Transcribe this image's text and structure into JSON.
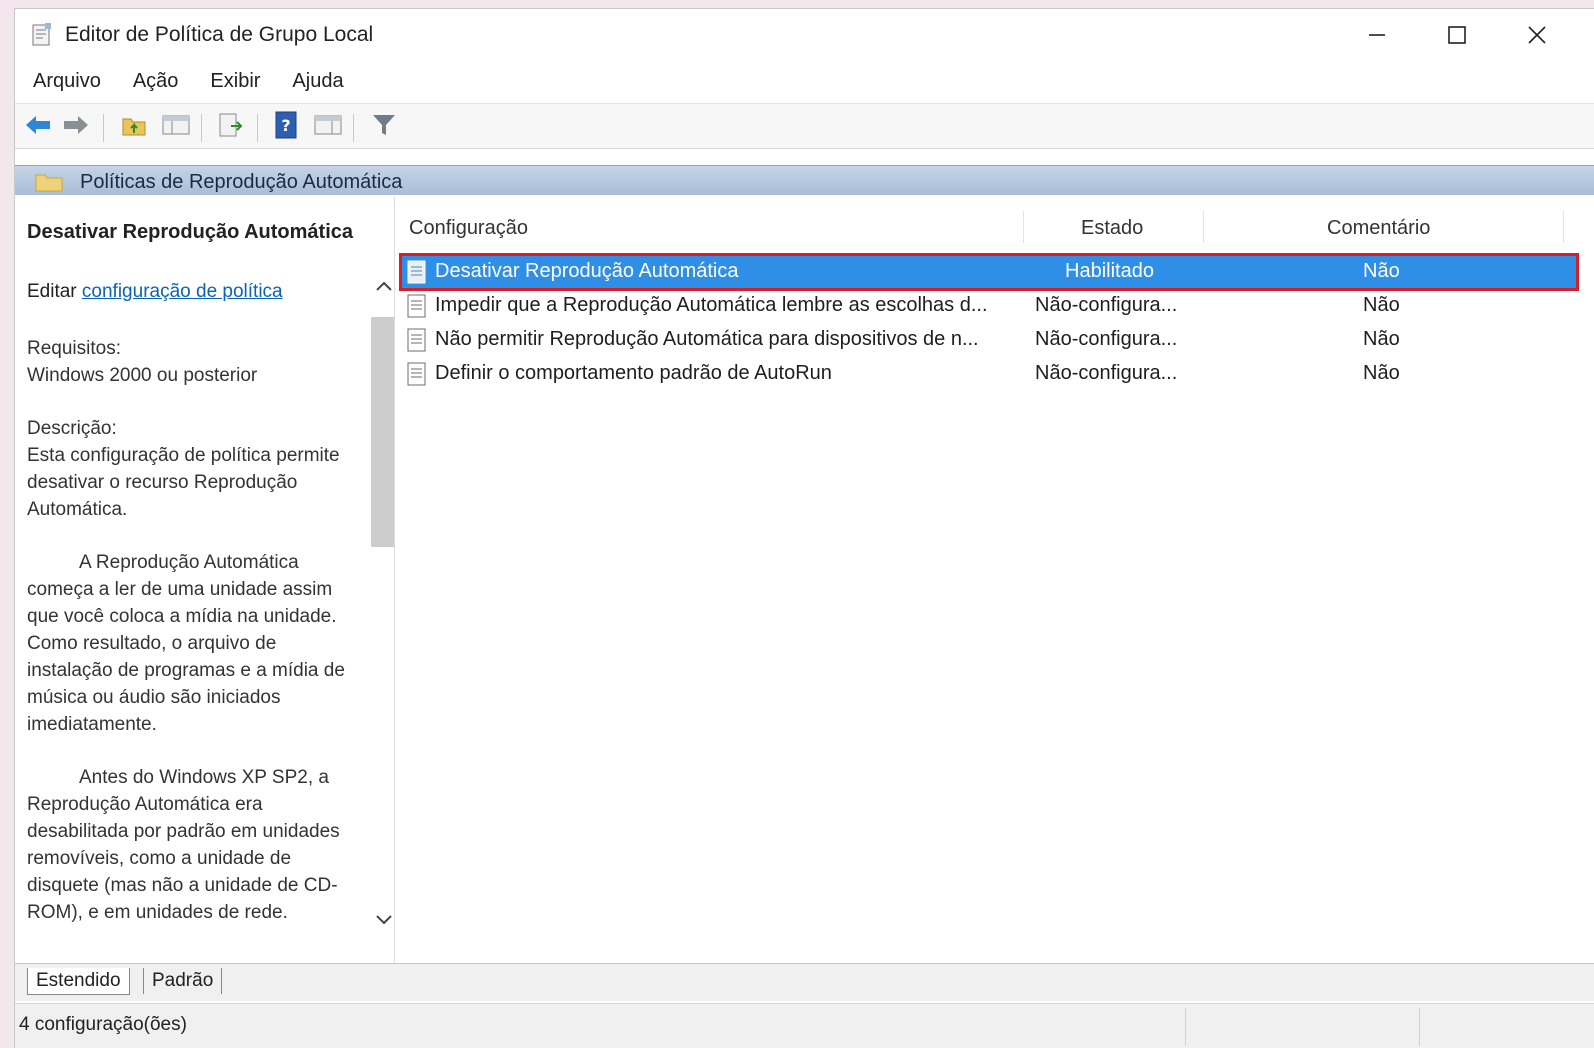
{
  "window": {
    "title": "Editor de Política de Grupo Local",
    "controls": {
      "minimize": "minimize-icon",
      "maximize": "maximize-icon",
      "close": "close-icon"
    }
  },
  "menu": [
    "Arquivo",
    "Ação",
    "Exibir",
    "Ajuda"
  ],
  "toolbar": {
    "icons": [
      "back-arrow-icon",
      "forward-arrow-icon",
      "up-folder-icon",
      "show-hide-tree-icon",
      "export-list-icon",
      "help-icon",
      "show-hide-action-pane-icon",
      "filter-icon"
    ]
  },
  "header": {
    "title": "Políticas de Reprodução Automática"
  },
  "description": {
    "title": "Desativar Reprodução Automática",
    "edit_prefix": "Editar",
    "edit_link": "configuração de política",
    "requirements_label": "Requisitos:",
    "requirements_value": "Windows 2000 ou posterior",
    "description_label": "Descrição:",
    "paragraph1": "Esta configuração de política permite desativar o recurso Reprodução Automática.",
    "paragraph2": "A Reprodução Automática começa a ler de uma unidade assim que você coloca a mídia na unidade. Como resultado, o arquivo de instalação de programas e a mídia de música ou áudio são iniciados imediatamente.",
    "paragraph3": "Antes do Windows XP SP2, a Reprodução Automática era desabilitada por padrão em unidades removíveis, como a unidade de disquete (mas não a unidade de CD-ROM), e em unidades de rede."
  },
  "list": {
    "columns": [
      "Configuração",
      "Estado",
      "Comentário"
    ],
    "rows": [
      {
        "setting": "Desativar Reprodução Automática",
        "state": "Habilitado",
        "comment": "Não",
        "selected": true
      },
      {
        "setting": "Impedir que a Reprodução Automática lembre as escolhas d...",
        "state": "Não-configura...",
        "comment": "Não",
        "selected": false
      },
      {
        "setting": "Não permitir Reprodução Automática para dispositivos de n...",
        "state": "Não-configura...",
        "comment": "Não",
        "selected": false
      },
      {
        "setting": "Definir o comportamento padrão de AutoRun",
        "state": "Não-configura...",
        "comment": "Não",
        "selected": false
      }
    ]
  },
  "tabs": [
    "Estendido",
    "Padrão"
  ],
  "status": {
    "text": "4 configuração(ões)"
  },
  "colors": {
    "selection": "#2f8fe6",
    "highlight_border": "#d4202c",
    "link": "#0a63b4"
  }
}
